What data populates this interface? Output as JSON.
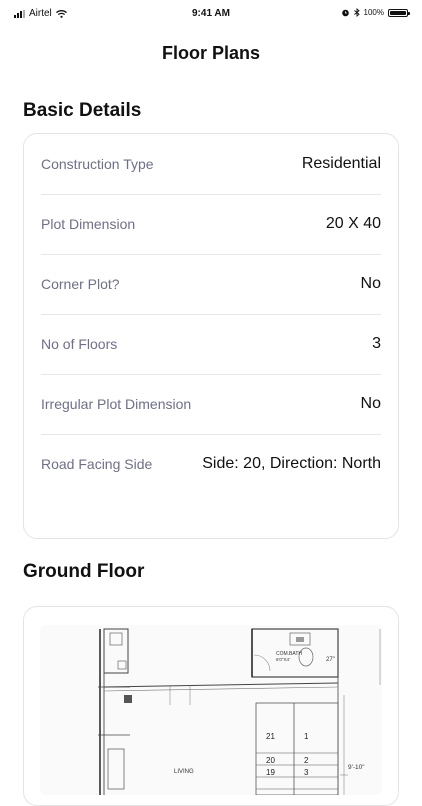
{
  "status_bar": {
    "carrier": "Airtel",
    "time": "9:41 AM",
    "battery_percent": "100%"
  },
  "nav": {
    "title": "Floor Plans"
  },
  "basic_details": {
    "title": "Basic Details",
    "rows": [
      {
        "label": "Construction Type",
        "value": "Residential"
      },
      {
        "label": "Plot Dimension",
        "value": "20 X 40"
      },
      {
        "label": "Corner Plot?",
        "value": "No"
      },
      {
        "label": "No of Floors",
        "value": "3"
      },
      {
        "label": "Irregular Plot Dimension",
        "value": "No"
      },
      {
        "label": "Road Facing Side",
        "value": "Side: 20, Direction: North"
      }
    ]
  },
  "ground_floor": {
    "title": "Ground Floor",
    "plan_labels": {
      "com_bath": "COM.BATH",
      "com_bath_size": "6'0\"X4'",
      "dim_27": "27\"",
      "dim_9_10": "9'-10\"",
      "living": "LIVING",
      "step_21": "21",
      "step_1": "1",
      "step_20": "20",
      "step_2": "2",
      "step_19": "19",
      "step_3": "3"
    }
  },
  "colors": {
    "label": "#6e6f8a",
    "value": "#111111",
    "card_border": "#e3e3ea",
    "divider": "#e6e6ec"
  }
}
